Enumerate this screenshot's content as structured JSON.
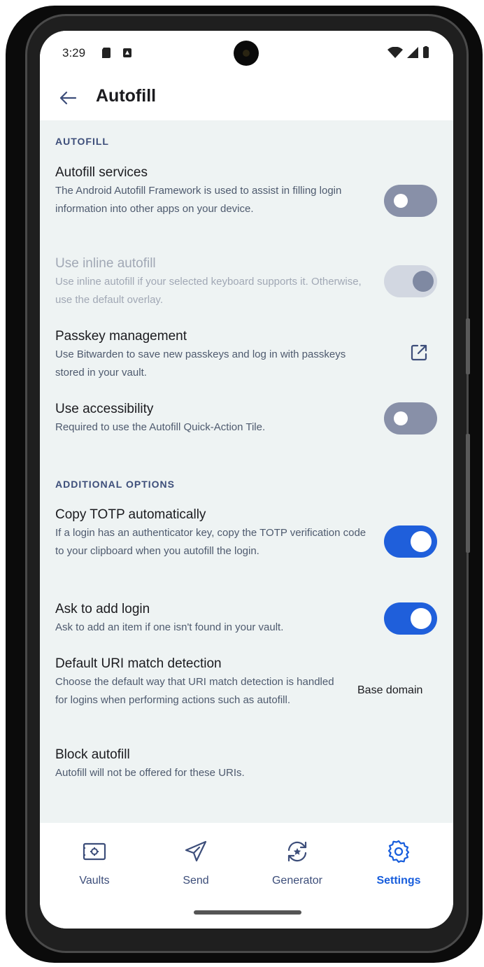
{
  "status_bar": {
    "time": "3:29"
  },
  "app_bar": {
    "title": "Autofill"
  },
  "sections": {
    "autofill": {
      "header": "AUTOFILL",
      "items": [
        {
          "title": "Autofill services",
          "description": "The Android Autofill Framework is used to assist in filling login information into other apps on your device.",
          "control": "toggle",
          "state": "off"
        },
        {
          "title": "Use inline autofill",
          "description": "Use inline autofill if your selected keyboard supports it. Otherwise, use the default overlay.",
          "control": "toggle",
          "state": "on-disabled"
        },
        {
          "title": "Passkey management",
          "description": "Use Bitwarden to save new passkeys and log in with passkeys stored in your vault.",
          "control": "external-link-icon"
        },
        {
          "title": "Use accessibility",
          "description": "Required to use the Autofill Quick-Action Tile.",
          "control": "toggle",
          "state": "off"
        }
      ]
    },
    "additional": {
      "header": "ADDITIONAL OPTIONS",
      "items": [
        {
          "title": "Copy TOTP automatically",
          "description": "If a login has an authenticator key, copy the TOTP verification code to your clipboard when you autofill the login.",
          "control": "toggle",
          "state": "on"
        },
        {
          "title": "Ask to add login",
          "description": "Ask to add an item if one isn't found in your vault.",
          "control": "toggle",
          "state": "on"
        },
        {
          "title": "Default URI match detection",
          "description": "Choose the default way that URI match detection is handled for logins when performing actions such as autofill.",
          "value": "Base domain"
        },
        {
          "title": "Block autofill",
          "description": "Autofill will not be offered for these URIs."
        }
      ]
    }
  },
  "bottom_nav": {
    "items": [
      {
        "label": "Vaults",
        "icon": "vault-icon",
        "active": false
      },
      {
        "label": "Send",
        "icon": "send-icon",
        "active": false
      },
      {
        "label": "Generator",
        "icon": "generator-icon",
        "active": false
      },
      {
        "label": "Settings",
        "icon": "gear-icon",
        "active": true
      }
    ]
  },
  "colors": {
    "accent": "#175ddc",
    "toggle_off": "#8890a8",
    "section_header": "#3d4e7a",
    "background": "#eef3f3"
  }
}
